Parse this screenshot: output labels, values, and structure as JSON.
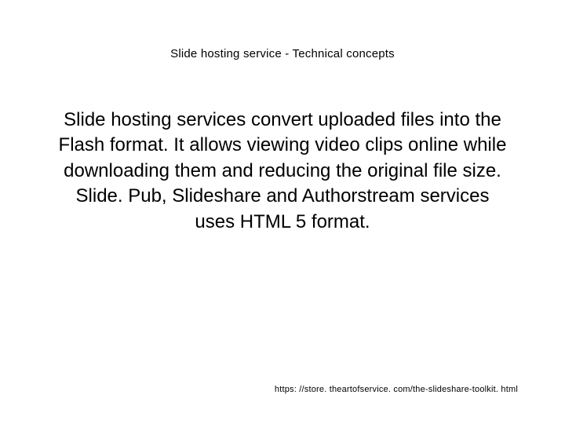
{
  "slide": {
    "title": "Slide hosting service -  Technical concepts",
    "body": "Slide hosting services convert uploaded files into the Flash format. It allows viewing video clips online while downloading them and reducing the original file size. Slide. Pub, Slideshare and Authorstream services uses HTML 5 format.",
    "footer_url": "https: //store. theartofservice. com/the-slideshare-toolkit. html"
  }
}
